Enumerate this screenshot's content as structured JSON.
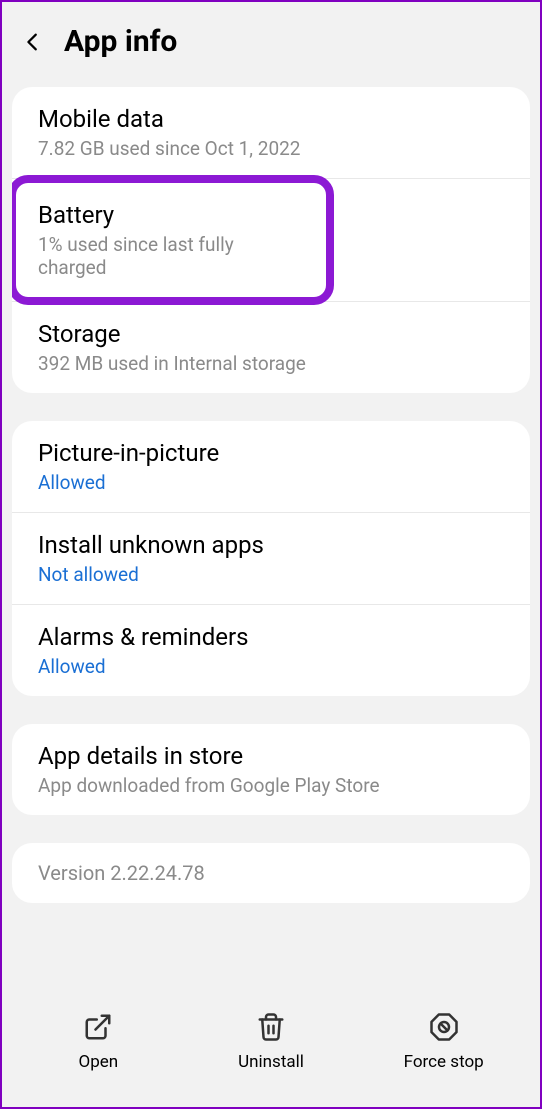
{
  "header": {
    "title": "App info"
  },
  "section1": {
    "mobile_data": {
      "title": "Mobile data",
      "sub": "7.82 GB used since Oct 1, 2022"
    },
    "battery": {
      "title": "Battery",
      "sub": "1% used since last fully charged"
    },
    "storage": {
      "title": "Storage",
      "sub": "392 MB used in Internal storage"
    }
  },
  "section2": {
    "pip": {
      "title": "Picture-in-picture",
      "sub": "Allowed"
    },
    "unknown": {
      "title": "Install unknown apps",
      "sub": "Not allowed"
    },
    "alarms": {
      "title": "Alarms & reminders",
      "sub": "Allowed"
    }
  },
  "section3": {
    "details": {
      "title": "App details in store",
      "sub": "App downloaded from Google Play Store"
    }
  },
  "section4": {
    "version": {
      "title": "Version 2.22.24.78"
    }
  },
  "footer": {
    "open": "Open",
    "uninstall": "Uninstall",
    "force_stop": "Force stop"
  }
}
